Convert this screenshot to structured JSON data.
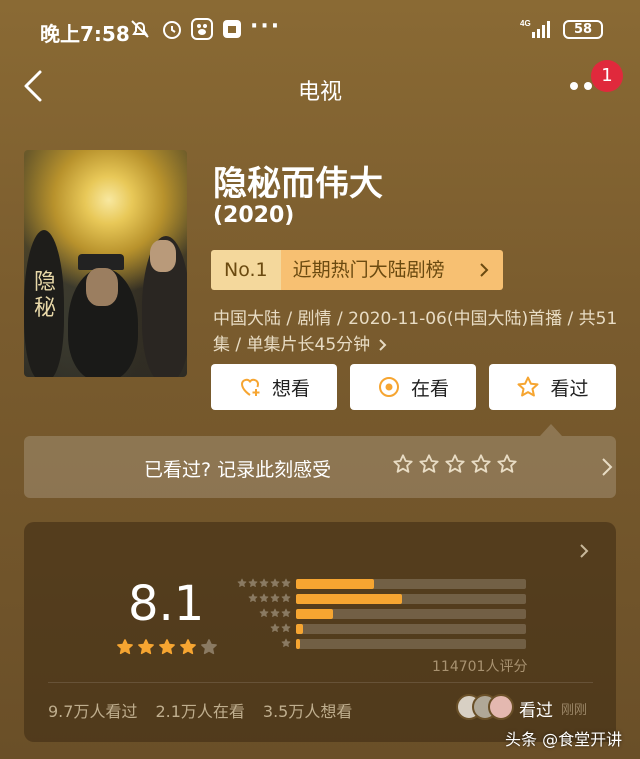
{
  "status_bar": {
    "time": "晚上7:58",
    "more": "···",
    "network": "4G",
    "battery": "58"
  },
  "nav": {
    "title": "电视",
    "badge_count": "1"
  },
  "show": {
    "title": "隐秘而伟大",
    "year": "(2020)",
    "rank_no": "No.1",
    "rank_label": "近期热门大陆剧榜",
    "meta_line1": "中国大陆 / 剧情 / 2020-11-06(中国大陆)首播 / 共51",
    "meta_line2": "集 / 单集片长45分钟"
  },
  "actions": {
    "want": "想看",
    "watching": "在看",
    "watched": "看过"
  },
  "record": {
    "prompt": "已看过? 记录此刻感受"
  },
  "rating": {
    "score": "8.1",
    "stars": 4,
    "distribution": [
      {
        "stars": 5,
        "fraction": 0.34
      },
      {
        "stars": 4,
        "fraction": 0.46
      },
      {
        "stars": 3,
        "fraction": 0.16
      },
      {
        "stars": 2,
        "fraction": 0.03
      },
      {
        "stars": 1,
        "fraction": 0.015
      }
    ],
    "count_text": "114701人评分",
    "stats": [
      "9.7万人看过",
      "2.1万人在看",
      "3.5万人想看"
    ],
    "seen_label": "看过",
    "seen_time": "刚刚"
  },
  "colors": {
    "accent": "#f6a531",
    "badge": "#e0293c",
    "rank_bg": "#f7c072"
  },
  "watermark": "头条 @食堂开讲"
}
